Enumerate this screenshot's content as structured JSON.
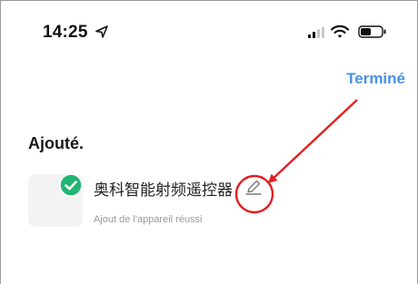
{
  "status_bar": {
    "time": "14:25",
    "location_icon": "location-arrow-icon",
    "signal_icon": "cellular-signal-icon",
    "wifi_icon": "wifi-icon",
    "battery_icon": "battery-icon"
  },
  "header": {
    "done_label": "Terminé",
    "accent_color": "#4a90e2"
  },
  "main": {
    "section_title": "Ajouté.",
    "device": {
      "name": "奥科智能射频遥控器",
      "status": "Ajout de l'appareil réussi",
      "check_icon": "check-circle-icon",
      "check_color": "#22b573",
      "edit_icon": "pencil-icon"
    }
  },
  "annotation": {
    "color": "#e02020",
    "shapes": [
      "arrow",
      "circle"
    ]
  }
}
